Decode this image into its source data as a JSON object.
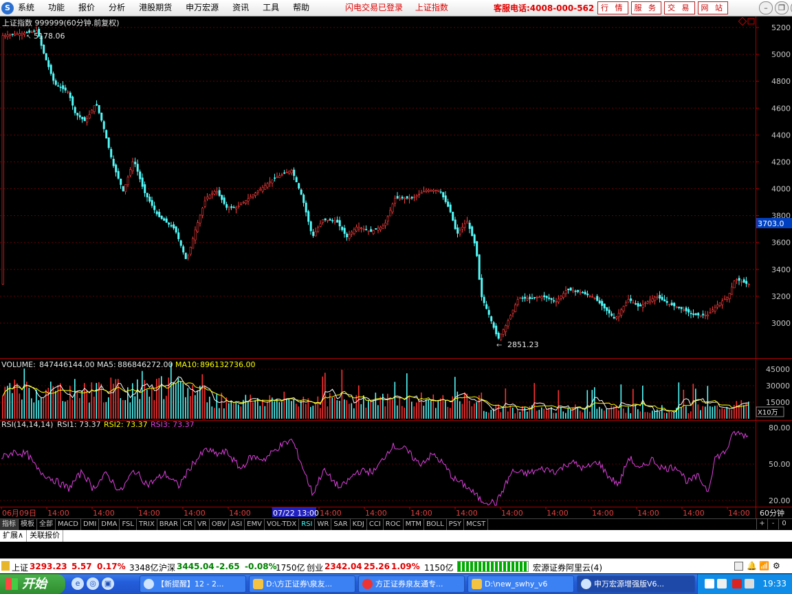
{
  "menubar": {
    "items": [
      "系统",
      "功能",
      "报价",
      "分析",
      "港股期货",
      "申万宏源",
      "资讯",
      "工具",
      "帮助"
    ],
    "status_login": "闪电交易已登录",
    "status_index": "上证指数",
    "hotline": "客服电话:4008-000-562",
    "buttons": [
      "行 情",
      "服 务",
      "交 易",
      "网 站"
    ]
  },
  "kline": {
    "title": "上证指数 999999(60分钟.前复权)",
    "high_label": "5178.06",
    "low_label": "2851.23",
    "current_tag": "3703.0",
    "yticks": [
      5200,
      5000,
      4800,
      4600,
      4400,
      4200,
      4000,
      3800,
      3600,
      3400,
      3200,
      3000
    ],
    "ylim": [
      2790,
      5280
    ]
  },
  "volume": {
    "label": "VOLUME:",
    "value": "847446144.00",
    "ma5_label": "MA5:",
    "ma5": "886846272.00",
    "ma10_label": "MA10:",
    "ma10": "896132736.00",
    "yticks": [
      45000,
      30000,
      15000
    ],
    "unit": "X10万",
    "colors": {
      "up": "#ff3232",
      "down": "#54fcfc",
      "ma5": "#ffffff",
      "ma10": "#ffff00"
    }
  },
  "rsi": {
    "label": "RSI(14,14,14)",
    "rsi1": "RSI1: 73.37",
    "rsi2": "RSI2: 73.37",
    "rsi3": "RSI3: 73.37",
    "yticks": [
      80,
      50,
      20
    ],
    "color": "#e040e0"
  },
  "xaxis": {
    "labels": [
      "06月09日",
      "14:00",
      "14:00",
      "14:00",
      "14:00",
      "14:00",
      "07/22 13:00",
      "14:00",
      "14:00",
      "14:00",
      "14:00",
      "14:00",
      "14:00",
      "14:00",
      "14:00",
      "14:00",
      "14:00",
      "14:00"
    ],
    "period": "60分钟"
  },
  "indicator_tabs": [
    "指标",
    "模板",
    "全部",
    "MACD",
    "DMI",
    "DMA",
    "FSL",
    "TRIX",
    "BRAR",
    "CR",
    "VR",
    "OBV",
    "ASI",
    "EMV",
    "VOL-TDX",
    "RSI",
    "WR",
    "SAR",
    "KDJ",
    "CCI",
    "ROC",
    "MTM",
    "BOLL",
    "PSY",
    "MCST"
  ],
  "active_tab": "RSI",
  "pager": [
    "+",
    "-",
    "0"
  ],
  "subtabs": [
    "扩展∧",
    "关联报价"
  ],
  "ticker": {
    "sh_label": "上证",
    "sh_value": "3293.23",
    "sh_change": "5.57",
    "sh_pct": "0.17%",
    "sh_amount": "3348亿",
    "hs_label": "沪深",
    "hs_value": "3445.04",
    "hs_change": "-2.65",
    "hs_pct": "-0.08%",
    "hs_amount": "1750亿",
    "cy_label": "创业",
    "cy_value": "2342.04",
    "cy_change": "25.26",
    "cy_pct": "1.09%",
    "cy_amount": "1150亿",
    "broker": "宏源证券阿里云(4)"
  },
  "taskbar": {
    "start": "开始",
    "tasks": [
      "【新提醒】12 - 2...",
      "D:\\方正证券\\泉友...",
      "方正证券泉友通专...",
      "D:\\new_swhy_v6",
      "申万宏源增强版V6..."
    ],
    "clock": "19:33"
  }
}
